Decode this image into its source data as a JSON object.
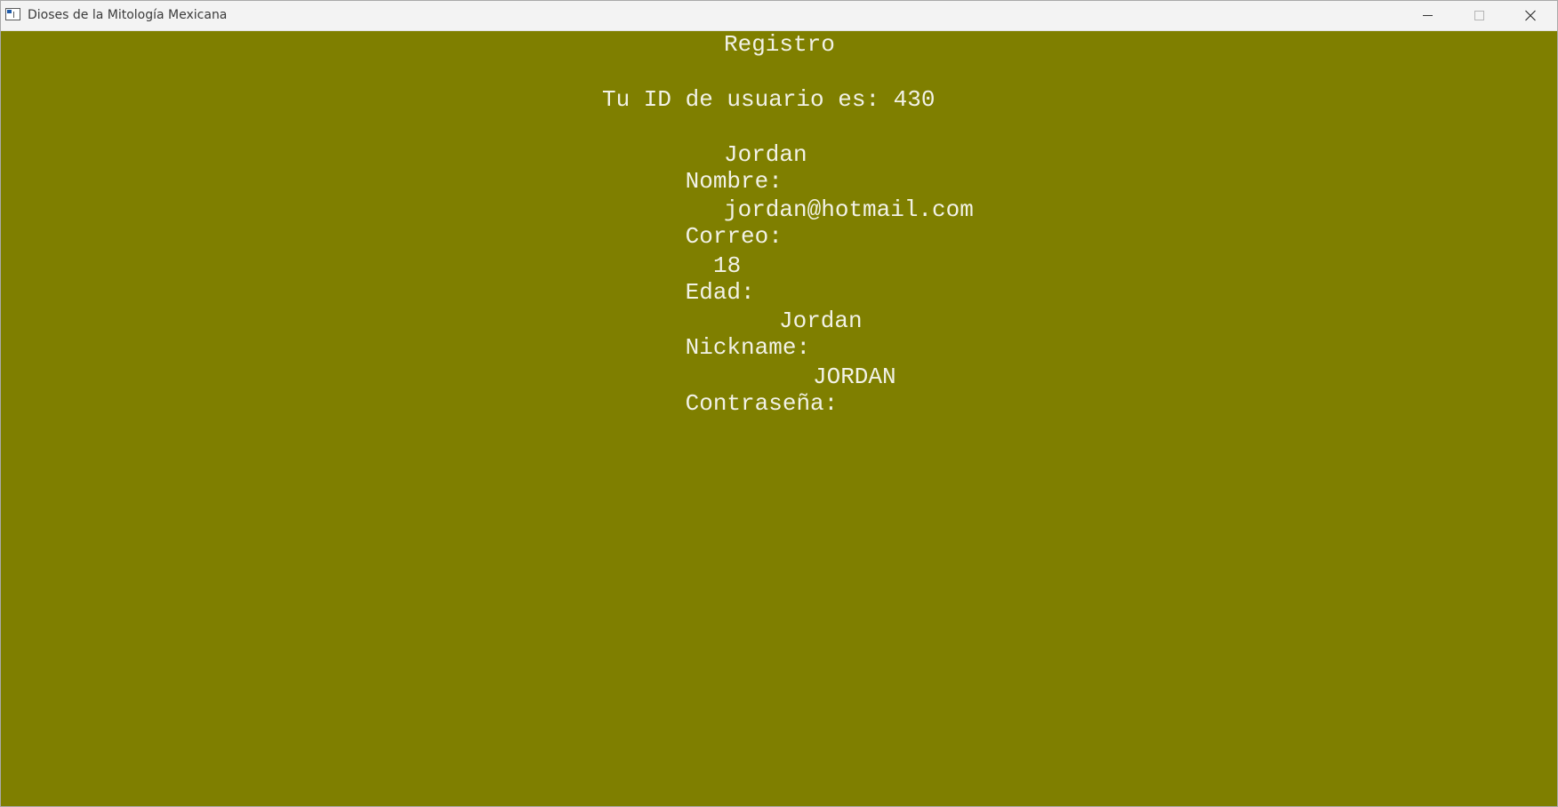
{
  "window": {
    "title": "Dioses de la Mitología Mexicana",
    "icon": "app-window-icon",
    "controls": [
      "minimize-icon",
      "maximize-icon",
      "close-icon"
    ]
  },
  "content": {
    "heading": "Registro",
    "id_line": "Tu ID de usuario es: 430",
    "fields": {
      "nombre": {
        "label": "Nombre:",
        "value": "Jordan"
      },
      "correo": {
        "label": "Correo:",
        "value": "jordan@hotmail.com"
      },
      "edad": {
        "label": "Edad:",
        "value": "18"
      },
      "nickname": {
        "label": "Nickname:",
        "value": "Jordan"
      },
      "contrasena": {
        "label": "Contraseña:",
        "value": "JORDAN"
      }
    }
  },
  "colors": {
    "background": "#7f7f00",
    "text": "#f2f2e6",
    "titlebar": "#f3f3f3"
  }
}
